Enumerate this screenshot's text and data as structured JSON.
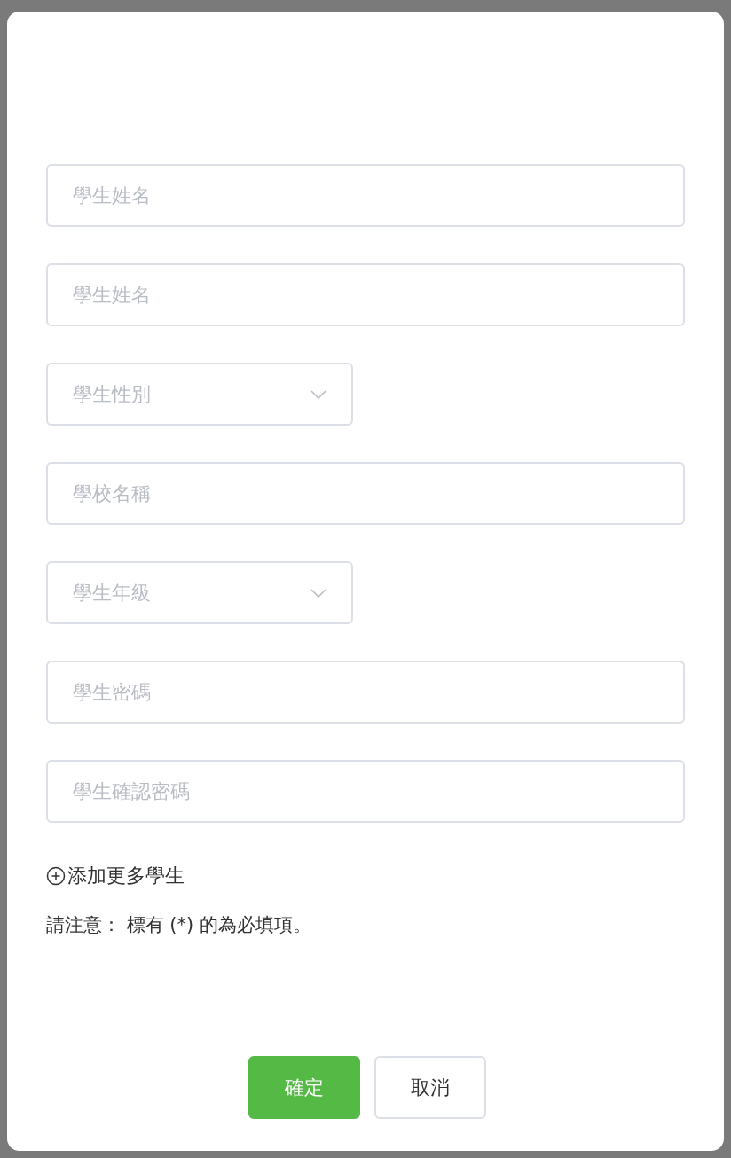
{
  "dialog": {
    "fields": [
      {
        "kind": "input",
        "placeholder": "學生姓名"
      },
      {
        "kind": "input",
        "placeholder": "學生姓名"
      },
      {
        "kind": "select",
        "placeholder": "學生性別"
      },
      {
        "kind": "input",
        "placeholder": "學校名稱"
      },
      {
        "kind": "select",
        "placeholder": "學生年級"
      },
      {
        "kind": "input",
        "placeholder": "學生密碼"
      },
      {
        "kind": "input",
        "placeholder": "學生確認密碼"
      }
    ],
    "add_link": "添加更多學生",
    "note": "請注意： 標有 (*) 的為必填項。",
    "buttons": [
      {
        "label": "確定",
        "kind": "primary"
      },
      {
        "label": "取消",
        "kind": "default"
      }
    ]
  }
}
